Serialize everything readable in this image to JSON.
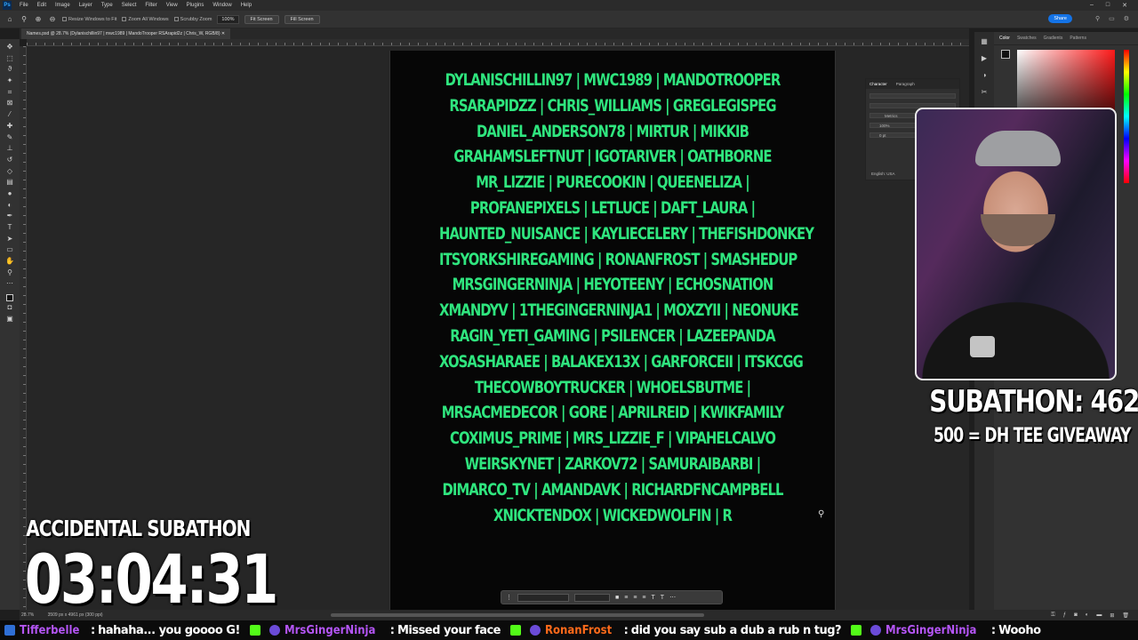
{
  "menubar": {
    "items": [
      "File",
      "Edit",
      "Image",
      "Layer",
      "Type",
      "Select",
      "Filter",
      "View",
      "Plugins",
      "Window",
      "Help"
    ]
  },
  "options": {
    "resize_windows": "Resize Windows to Fit",
    "zoom_all": "Zoom All Windows",
    "scrubby_zoom": "Scrubby Zoom",
    "zoom_value": "100%",
    "fit_screen": "Fit Screen",
    "fill_screen": "Fill Screen",
    "share": "Share"
  },
  "document": {
    "tab_title": "Names.psd @ 28.7% (Dylanischillin97 | mwc1989 | MandoTrooper RSArapid2z | Chris_W, RGB/8)",
    "zoom_status": "28.7%",
    "dimensions_status": "3509 px x 4961 px (300 ppi)"
  },
  "canvas_lines": [
    "DYLANISCHILLIN97 | MWC1989 | MANDOTROOPER",
    "RSARAPIDZZ | CHRIS_WILLIAMS | GREGLEGISPEG",
    "DANIEL_ANDERSON78 | MIRTUR | MIKKIB",
    "GRAHAMSLEFTNUT | IGOTARIVER | OATHBORNE",
    "MR_LIZZIE | PURECOOKIN | QUEENELIZA |",
    "PROFANEPIXELS | LETLUCE | DAFT_LAURA |",
    "HAUNTED_NUISANCE | KAYLIECELERY | THEFISHDONKEY",
    "ITSYORKSHIREGAMING | RONANFROST | SMASHEDUP",
    "MRSGINGERNINJA | HEYOTEENY | ECHOSNATION",
    "XMANDYV | 1THEGINGERNINJA1 | MOXZYII | NEONUKE",
    "RAGIN_YETI_GAMING | PSILENCER | LAZEEPANDA",
    "XOSASHARAEE | BALAKEX13X | GARFORCEII | ITSKCGG",
    "THECOWBOYTRUCKER | WHOELSBUTME |",
    "MRSACMEDECOR | GORE | APRILREID | KWIKFAMILY",
    "COXIMUS_PRIME | MRS_LIZZIE_F | VIPAHELCALVO",
    "WEIRSKYNET | ZARKOV72 | SAMURAIBARBI |",
    "DIMARCO_TV | AMANDAVK | RICHARDFNCAMPBELL",
    "XNICKTENDOX | WICKEDWOLFIN | R"
  ],
  "panels": {
    "color_tabs": [
      "Color",
      "Swatches",
      "Gradients",
      "Patterns"
    ],
    "char_tabs": [
      "Character",
      "Paragraph"
    ],
    "language": "English: USA",
    "metrics": "Metrics",
    "scale": "100%",
    "baseline": "0 pt"
  },
  "overlay": {
    "subathon_count": "SUBATHON: 462",
    "giveaway": "500 = DH TEE GIVEAWAY",
    "title": "ACCIDENTAL SUBATHON",
    "timer": "03:04:31"
  },
  "chat": [
    {
      "user": "Tifferbelle",
      "sep": ":",
      "msg": "hahaha... you goooo G!",
      "color": "#b455f5"
    },
    {
      "user": "MrsGingerNinja",
      "sep": ":",
      "msg": "Missed your face",
      "color": "#b455f5"
    },
    {
      "user": "RonanFrost",
      "sep": ":",
      "msg": "did you say sub a dub a rub n tug?",
      "color": "#ff6a1a"
    },
    {
      "user": "MrsGingerNinja",
      "sep": ":",
      "msg": "Wooho",
      "color": "#b455f5"
    }
  ],
  "colors": {
    "canvas_text": "#2fe57e",
    "accent": "#1473e6",
    "chat_purple": "#b455f5",
    "chat_orange": "#ff6a1a"
  }
}
